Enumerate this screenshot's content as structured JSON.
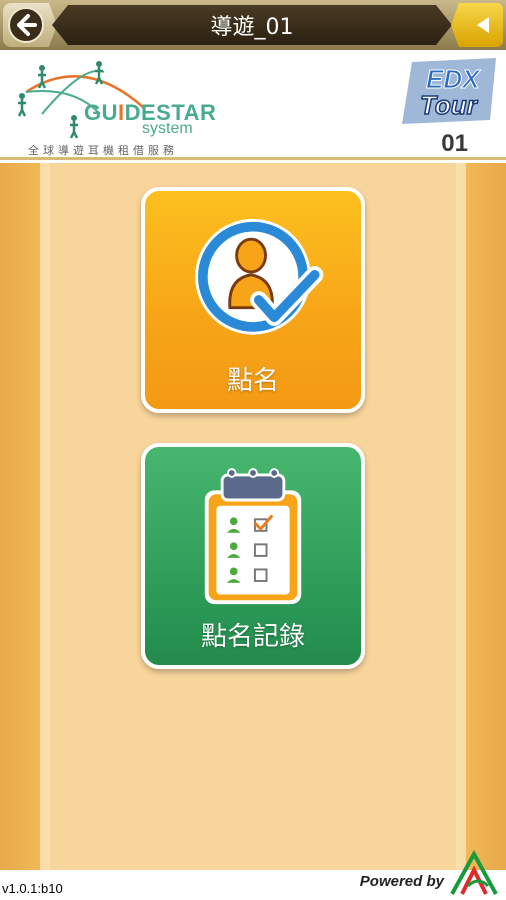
{
  "topbar": {
    "title": "導遊_01",
    "back_icon": "back-arrow-icon",
    "menu_icon": "triangle-left-icon"
  },
  "header": {
    "brand_name_part1": "GU",
    "brand_name_part2": "DESTAR",
    "brand_system": "system",
    "brand_tagline": "全球導遊耳機租借服務",
    "edx_logo_text_top": "EDX",
    "edx_logo_text_bottom": "Tour",
    "tour_number": "01"
  },
  "tiles": [
    {
      "label": "點名",
      "icon": "person-check-icon",
      "color": "#f7a418"
    },
    {
      "label": "點名記錄",
      "icon": "clipboard-checklist-icon",
      "color": "#2f9e5a"
    }
  ],
  "footer": {
    "version": "v1.0.1:b10",
    "powered_by": "Powered by"
  },
  "colors": {
    "accent_orange": "#f7a418",
    "accent_green": "#2f9e5a",
    "topbar_dark": "#2b2112",
    "brand_teal": "#4aaa8e",
    "logo_red": "#e02a2a",
    "logo_green": "#1a9a3a"
  }
}
